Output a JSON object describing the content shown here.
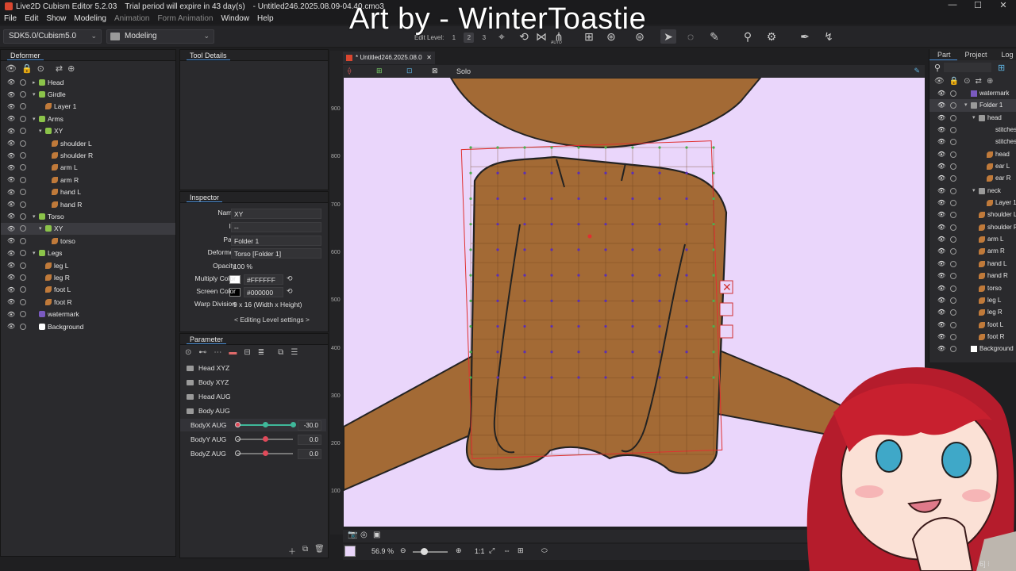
{
  "window": {
    "title": "Live2D Cubism Editor 5.2.03",
    "trial": "Trial period will expire in 43 day(s)",
    "filename": "Untitled246.2025.08.09-04.40.cmo3",
    "controls": [
      "—",
      "☐",
      "✕"
    ]
  },
  "overlay_title": "Art by - WinterToastie",
  "menu": [
    "File",
    "Edit",
    "Show",
    "Modeling",
    "Animation",
    "Form Animation",
    "Window",
    "Help"
  ],
  "toolbar": {
    "sdk_select": "SDK5.0/Cubism5.0",
    "mode_select": "Modeling",
    "edit_level_label": "Edit Level:",
    "edit_levels": [
      "1",
      "2",
      "3"
    ],
    "auto_label": "AUTO"
  },
  "deformer_panel": {
    "title": "Deformer",
    "items": [
      {
        "label": "Head",
        "type": "warp",
        "depth": 0
      },
      {
        "label": "Girdle",
        "type": "warp",
        "depth": 0
      },
      {
        "label": "Layer 1",
        "type": "art",
        "depth": 1
      },
      {
        "label": "Arms",
        "type": "warp",
        "depth": 0
      },
      {
        "label": "XY",
        "type": "warp",
        "depth": 1
      },
      {
        "label": "shoulder L",
        "type": "art",
        "depth": 2
      },
      {
        "label": "shoulder R",
        "type": "art",
        "depth": 2
      },
      {
        "label": "arm L",
        "type": "art",
        "depth": 2
      },
      {
        "label": "arm R",
        "type": "art",
        "depth": 2
      },
      {
        "label": "hand L",
        "type": "art",
        "depth": 2
      },
      {
        "label": "hand R",
        "type": "art",
        "depth": 2
      },
      {
        "label": "Torso",
        "type": "warp",
        "depth": 0
      },
      {
        "label": "XY",
        "type": "warp",
        "depth": 1
      },
      {
        "label": "torso",
        "type": "art",
        "depth": 2
      },
      {
        "label": "Legs",
        "type": "warp",
        "depth": 0
      },
      {
        "label": "leg L",
        "type": "art",
        "depth": 1
      },
      {
        "label": "leg R",
        "type": "art",
        "depth": 1
      },
      {
        "label": "foot L",
        "type": "art",
        "depth": 1
      },
      {
        "label": "foot R",
        "type": "art",
        "depth": 1
      },
      {
        "label": "watermark",
        "type": "purple",
        "depth": 0
      },
      {
        "label": "Background",
        "type": "white",
        "depth": 0
      }
    ]
  },
  "tool_details": {
    "title": "Tool Details"
  },
  "inspector": {
    "title": "Inspector",
    "rows": [
      {
        "key": "Name",
        "value": "XY"
      },
      {
        "key": "ID",
        "value": "--"
      },
      {
        "key": "Part",
        "value": "Folder 1"
      },
      {
        "key": "Deformer",
        "value": "Torso  [Folder 1]"
      },
      {
        "key": "Opacity",
        "value": "100 %"
      },
      {
        "key": "Multiply Color",
        "value": "#FFFFFF"
      },
      {
        "key": "Screen Color",
        "value": "#000000"
      },
      {
        "key": "Warp Division",
        "value": "9  x   16 (Width x Height)"
      }
    ],
    "editing_level": "< Editing Level settings >",
    "multiply_swatch": "#ffffff",
    "screen_swatch": "#000000"
  },
  "parameter_panel": {
    "title": "Parameter",
    "groups": [
      "Head XYZ",
      "Body XYZ",
      "Head AUG",
      "Body AUG"
    ],
    "params": [
      {
        "name": "BodyX AUG",
        "value": "-30.0",
        "fraction": 1.0
      },
      {
        "name": "BodyY AUG",
        "value": "0.0",
        "fraction": 0.5
      },
      {
        "name": "BodyZ AUG",
        "value": "0.0",
        "fraction": 0.5
      }
    ]
  },
  "canvas": {
    "tab": "* Untitled246.2025.08.0",
    "solo_label": "Solo",
    "ruler_labels": [
      "900",
      "800",
      "700",
      "600",
      "500",
      "400",
      "300",
      "200",
      "100"
    ],
    "zoom": "56.9 %",
    "ratio": "1:1",
    "background_color": "#ead6fb",
    "skin_color": "#a36a35"
  },
  "right_panel": {
    "tabs": [
      "Part",
      "Project",
      "Log"
    ],
    "items": [
      {
        "label": "watermark",
        "type": "purple",
        "depth": 0
      },
      {
        "label": "Folder 1",
        "type": "folder",
        "depth": 0
      },
      {
        "label": "head",
        "type": "folder",
        "depth": 1
      },
      {
        "label": "stitches",
        "type": "none",
        "depth": 2
      },
      {
        "label": "stitches",
        "type": "none",
        "depth": 2
      },
      {
        "label": "head",
        "type": "art",
        "depth": 2
      },
      {
        "label": "ear L",
        "type": "art",
        "depth": 2
      },
      {
        "label": "ear R",
        "type": "art",
        "depth": 2
      },
      {
        "label": "neck",
        "type": "folder",
        "depth": 1
      },
      {
        "label": "Layer 1",
        "type": "art",
        "depth": 2
      },
      {
        "label": "shoulder L",
        "type": "art",
        "depth": 1
      },
      {
        "label": "shoulder R",
        "type": "art",
        "depth": 1
      },
      {
        "label": "arm L",
        "type": "art",
        "depth": 1
      },
      {
        "label": "arm R",
        "type": "art",
        "depth": 1
      },
      {
        "label": "hand L",
        "type": "art",
        "depth": 1
      },
      {
        "label": "hand R",
        "type": "art",
        "depth": 1
      },
      {
        "label": "torso",
        "type": "art",
        "depth": 1
      },
      {
        "label": "leg L",
        "type": "art",
        "depth": 1
      },
      {
        "label": "leg R",
        "type": "art",
        "depth": 1
      },
      {
        "label": "foot L",
        "type": "art",
        "depth": 1
      },
      {
        "label": "foot R",
        "type": "art",
        "depth": 1
      },
      {
        "label": "Background",
        "type": "white",
        "depth": 0
      }
    ]
  },
  "corner_text": "6] ⁝"
}
